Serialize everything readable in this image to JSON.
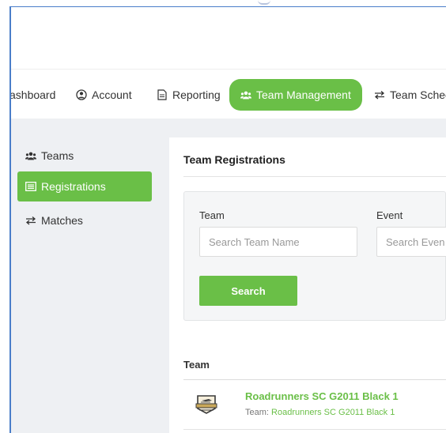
{
  "nav": {
    "items": [
      {
        "label": "ashboard",
        "icon": "none"
      },
      {
        "label": "Account",
        "icon": "user-circle-icon"
      },
      {
        "label": "Reporting",
        "icon": "document-icon"
      },
      {
        "label": "Team Management",
        "icon": "users-icon",
        "active": true
      },
      {
        "label": "Team Schec",
        "icon": "exchange-icon"
      }
    ]
  },
  "sidebar": {
    "items": [
      {
        "label": "Teams",
        "icon": "users-icon"
      },
      {
        "label": "Registrations",
        "icon": "list-icon",
        "active": true
      },
      {
        "label": "Matches",
        "icon": "exchange-icon"
      }
    ]
  },
  "panel": {
    "title": "Team Registrations"
  },
  "search": {
    "team_label": "Team",
    "team_placeholder": "Search Team Name",
    "event_label": "Event",
    "event_placeholder": "Search Even",
    "button_label": "Search"
  },
  "table": {
    "header": "Team",
    "rows": [
      {
        "title": "Roadrunners SC G2011 Black 1",
        "sub_key": "Team:",
        "sub_value": "Roadrunners SC G2011 Black 1"
      }
    ]
  },
  "colors": {
    "accent": "#6abf47",
    "sidebar_bg": "#eef0f3"
  }
}
